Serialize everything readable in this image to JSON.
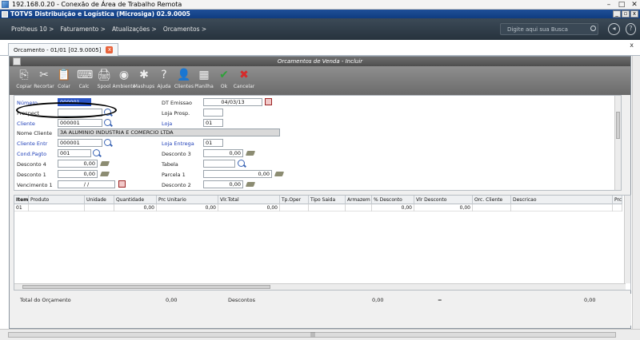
{
  "rdp": {
    "title": "192.168.0.20 - Conexão de Área de Trabalho Remota",
    "ctrls": [
      "–",
      "□",
      "✕"
    ]
  },
  "app": {
    "title": "TOTVS Distribuição e Logística (Microsiga) 02.9.0005",
    "ctrls": [
      "_",
      "▫",
      "x"
    ]
  },
  "nav": {
    "crumbs": [
      "Protheus 10 >",
      "Faturamento >",
      "Atualizações >",
      "Orcamentos >"
    ],
    "search_placeholder": "Digite aqui sua Busca",
    "icons": [
      "back-icon",
      "help-icon",
      "exit-icon"
    ]
  },
  "tab": {
    "label": "Orcamento - 01/01 [02.9.0005]",
    "close": "x"
  },
  "window": {
    "title": "Orcamentos de Venda - Incluir",
    "close": "x"
  },
  "toolbar": {
    "items": [
      {
        "label": "Copiar",
        "glyph": "⎘"
      },
      {
        "label": "Recortar",
        "glyph": "✂"
      },
      {
        "label": "Colar",
        "glyph": "📋"
      },
      {
        "label": "Calc",
        "glyph": "⌨"
      },
      {
        "label": "Spool",
        "glyph": "🖨"
      },
      {
        "label": "Ambiente",
        "glyph": "◉"
      },
      {
        "label": "Mashups",
        "glyph": "✱"
      },
      {
        "label": "Ajuda",
        "glyph": "?"
      },
      {
        "label": "Clientes",
        "glyph": "👤"
      },
      {
        "label": "Planilha",
        "glyph": "▦"
      },
      {
        "label": "Ok",
        "glyph": "✔"
      },
      {
        "label": "Cancelar",
        "glyph": "✖"
      }
    ]
  },
  "fields": {
    "numero": {
      "label": "Número",
      "value": "000001"
    },
    "dt_emissao": {
      "label": "DT Emissao",
      "value": "04/03/13"
    },
    "prospect": {
      "label": "Prospect",
      "value": ""
    },
    "loja_prosp": {
      "label": "Loja Prosp.",
      "value": ""
    },
    "cliente": {
      "label": "Cliente",
      "value": "000001"
    },
    "loja": {
      "label": "Loja",
      "value": "01"
    },
    "nome_cliente": {
      "label": "Nome Cliente",
      "value": "3A ALUMINIO INDUSTRIA E COMERCIO LTDA"
    },
    "cliente_entr": {
      "label": "Cliente Entr",
      "value": "000001"
    },
    "loja_entrega": {
      "label": "Loja Entrega",
      "value": "01"
    },
    "cond_pagto": {
      "label": "Cond.Pagto",
      "value": "001"
    },
    "desconto3": {
      "label": "Desconto 3",
      "value": "0,00"
    },
    "desconto4": {
      "label": "Desconto 4",
      "value": "0,00"
    },
    "tabela": {
      "label": "Tabela",
      "value": ""
    },
    "desconto1": {
      "label": "Desconto 1",
      "value": "0,00"
    },
    "parcela1": {
      "label": "Parcela 1",
      "value": "0,00"
    },
    "vencimento1": {
      "label": "Vencimento 1",
      "value": "/ /"
    },
    "desconto2": {
      "label": "Desconto 2",
      "value": "0,00"
    }
  },
  "grid": {
    "headers": [
      "Item",
      "Produto",
      "Unidade",
      "Quantidade",
      "Prc Unitario",
      "Vlr.Total",
      "Tp.Oper",
      "Tipo Saida",
      "Armazem",
      "% Desconto",
      "Vlr Desconto",
      "Orc. Cliente",
      "Descricao",
      "Prc"
    ],
    "row": [
      "01",
      "",
      "",
      "0,00",
      "0,00",
      "0,00",
      "",
      "",
      "",
      "0,00",
      "0,00",
      "",
      "",
      ""
    ]
  },
  "footer": {
    "total_label": "Total do Orçamento",
    "total_value": "0,00",
    "descontos_label": "Descontos",
    "descontos_value": "0,00",
    "eq": "=",
    "net_value": "0,00"
  }
}
